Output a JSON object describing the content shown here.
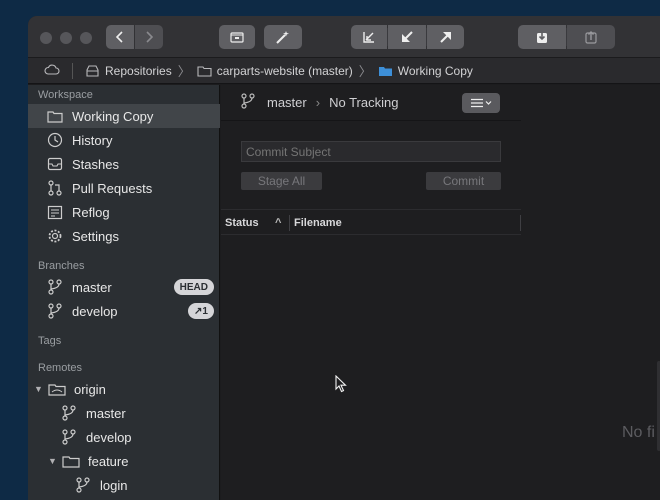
{
  "toolbar": {
    "buttons": [
      "back-icon",
      "forward-icon",
      "sidebar-toggle-icon",
      "magic-wand-icon",
      "fetch-icon",
      "pull-icon",
      "push-icon",
      "stash-icon",
      "pop-stash-icon"
    ]
  },
  "breadcrumb": {
    "repositories": "Repositories",
    "repo": "carparts-website (master)",
    "current": "Working Copy"
  },
  "sidebar": {
    "workspace_title": "Workspace",
    "workspace_items": [
      {
        "label": "Working Copy",
        "icon": "working-copy-icon"
      },
      {
        "label": "History",
        "icon": "history-icon"
      },
      {
        "label": "Stashes",
        "icon": "stash-box-icon"
      },
      {
        "label": "Pull Requests",
        "icon": "pull-request-icon"
      },
      {
        "label": "Reflog",
        "icon": "reflog-icon"
      },
      {
        "label": "Settings",
        "icon": "gear-icon"
      }
    ],
    "branches_title": "Branches",
    "branches": [
      {
        "label": "master",
        "badge": "HEAD"
      },
      {
        "label": "develop",
        "badge": "↗1"
      }
    ],
    "tags_title": "Tags",
    "remotes_title": "Remotes",
    "remote_name": "origin",
    "remote_branches": [
      "master",
      "develop"
    ],
    "folder_name": "feature",
    "folder_branches": [
      "login"
    ]
  },
  "main": {
    "branch": "master",
    "tracking": "No Tracking",
    "commit_placeholder": "Commit Subject",
    "stage_all": "Stage All",
    "commit": "Commit",
    "col_status": "Status",
    "col_filename": "Filename",
    "empty_text": "No fi"
  },
  "colors": {
    "window_bg": "#1c1c1e",
    "sidebar_bg": "#2b2f33",
    "selected_row": "#414549",
    "desktop": "#0e2a45"
  }
}
